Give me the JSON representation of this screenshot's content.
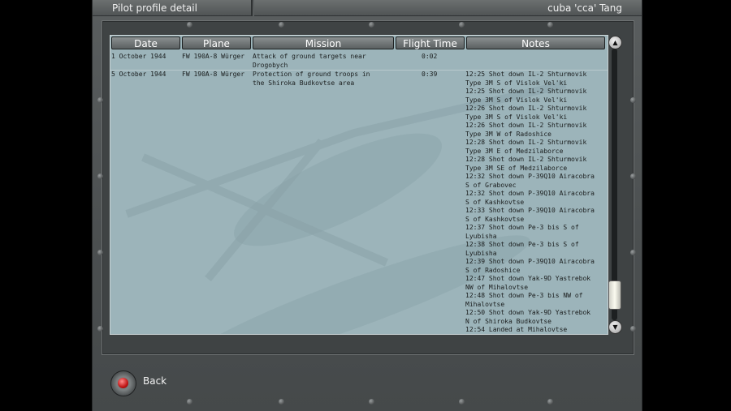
{
  "window": {
    "title": "Pilot profile detail",
    "pilot_name": "cuba 'cca' Tang"
  },
  "table": {
    "columns": [
      "Date",
      "Plane",
      "Mission",
      "Flight Time",
      "Notes"
    ],
    "rows": [
      {
        "date": "1 October 1944",
        "plane": "FW 190A-8 Würger",
        "mission": "Attack of ground targets near\nDrogobych",
        "flight_time": "0:02",
        "notes": ""
      },
      {
        "date": "5 October 1944",
        "plane": "FW 190A-8 Würger",
        "mission": "Protection of ground troops in\nthe Shiroka Budkovtse area",
        "flight_time": "0:39",
        "notes": "12:25 Shot down IL-2 Shturmovik\nType 3M S of Vislok Vel'ki\n12:25 Shot down IL-2 Shturmovik\nType 3M S of Vislok Vel'ki\n12:26 Shot down IL-2 Shturmovik\nType 3M S of Vislok Vel'ki\n12:26 Shot down IL-2 Shturmovik\nType 3M W of Radoshice\n12:28 Shot down IL-2 Shturmovik\nType 3M E of Medzilaborce\n12:28 Shot down IL-2 Shturmovik\nType 3M SE of Medzilaborce\n12:32 Shot down P-39Q10 Airacobra\nS of Grabovec\n12:32 Shot down P-39Q10 Airacobra\nS of Kashkovtse\n12:33 Shot down P-39Q10 Airacobra\nS of Kashkovtse\n12:37 Shot down Pe-3 bis S of\nLyubisha\n12:38 Shot down Pe-3 bis S of\nLyubisha\n12:39 Shot down P-39Q10 Airacobra\nS of Radoshice\n12:47 Shot down Yak-9D Yastrebok\nNW of Mihalovtse\n12:48 Shot down Pe-3 bis NW of\nMihalovtse\n12:50 Shot down Yak-9D Yastrebok\nN of Shiroka Budkovtse\n12:54 Landed at Mihalovtse"
      }
    ]
  },
  "scrollbar": {
    "up_icon": "arrow-up-icon",
    "down_icon": "arrow-down-icon",
    "position_fraction": 0.95
  },
  "back": {
    "label": "Back",
    "icon": "red-dot-icon"
  },
  "colors": {
    "panel_bg": "#9cb4ba",
    "frame": "#505455",
    "header_btn": "#6e7374"
  }
}
